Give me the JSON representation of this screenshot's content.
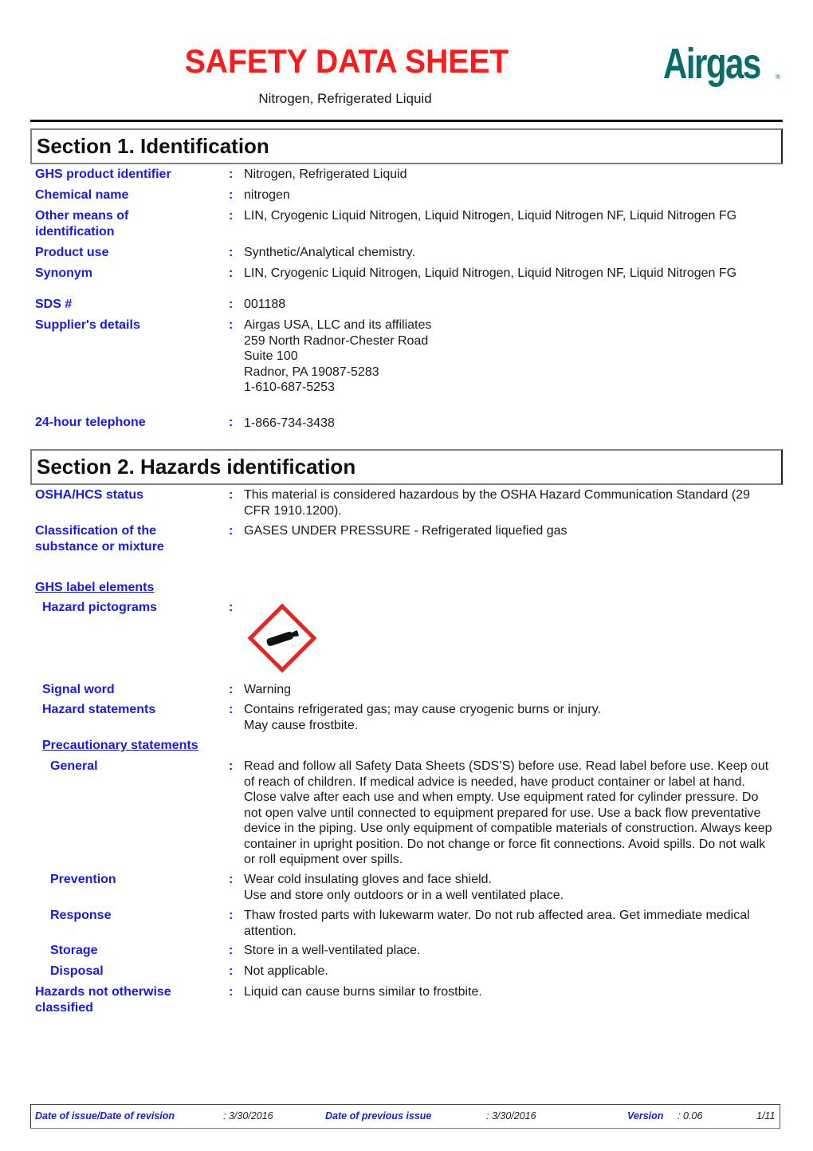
{
  "header": {
    "title": "SAFETY DATA SHEET",
    "subtitle": "Nitrogen, Refrigerated Liquid",
    "logo_text": "Airgas",
    "logo_reg": "®",
    "brand_color": "#0a6b6b",
    "title_color": "#ff1a1a"
  },
  "section1": {
    "title": "Section 1. Identification",
    "rows": [
      {
        "label": "GHS product identifier",
        "value": "Nitrogen, Refrigerated Liquid"
      },
      {
        "label": "Chemical name",
        "value": "nitrogen"
      },
      {
        "label": "Other means of identification",
        "value": "LIN, Cryogenic Liquid Nitrogen, Liquid Nitrogen, Liquid Nitrogen NF, Liquid Nitrogen FG"
      },
      {
        "label": "Product use",
        "value": "Synthetic/Analytical chemistry."
      },
      {
        "label": "Synonym",
        "value": "LIN, Cryogenic Liquid Nitrogen, Liquid Nitrogen, Liquid Nitrogen NF, Liquid Nitrogen FG"
      },
      {
        "label": "SDS #",
        "value": "001188"
      },
      {
        "label": "Supplier's details",
        "value": "Airgas USA, LLC and its affiliates\n259 North Radnor-Chester Road\nSuite 100\nRadnor, PA 19087-5283\n1-610-687-5253"
      },
      {
        "label": "24-hour telephone",
        "value": "1-866-734-3438"
      }
    ]
  },
  "section2": {
    "title": "Section 2. Hazards identification",
    "osha_status": {
      "label": "OSHA/HCS status",
      "value": "This material is considered hazardous by the OSHA Hazard Communication Standard (29 CFR 1910.1200)."
    },
    "classification": {
      "label": "Classification of the substance or mixture",
      "value": "GASES UNDER PRESSURE - Refrigerated liquefied gas"
    },
    "ghs_label_elements": "GHS label elements",
    "hazard_pictograms": {
      "label": "Hazard pictograms",
      "icon": "gas-cylinder-icon"
    },
    "signal_word": {
      "label": "Signal word",
      "value": "Warning"
    },
    "hazard_statements": {
      "label": "Hazard statements",
      "value": "Contains refrigerated gas; may cause cryogenic burns or injury.\nMay cause frostbite."
    },
    "precautionary_statements": "Precautionary statements",
    "general": {
      "label": "General",
      "value": "Read and follow all Safety Data Sheets (SDS’S) before use.  Read label before use.  Keep out of reach of children.  If medical advice is needed, have product container or label at hand.  Close valve after each use and when empty.  Use equipment rated for cylinder pressure.  Do not open valve until connected to equipment prepared for use.  Use a back flow preventative device in the piping.  Use only equipment of compatible materials of construction.  Always keep container in upright position.  Do not change or force fit connections.  Avoid spills. Do not walk or roll equipment over spills."
    },
    "prevention": {
      "label": "Prevention",
      "value": "Wear cold insulating gloves and face shield.\nUse and store only outdoors or in a well ventilated place."
    },
    "response": {
      "label": "Response",
      "value": "Thaw frosted parts with lukewarm water.  Do not rub affected area.  Get immediate medical attention."
    },
    "storage": {
      "label": "Storage",
      "value": "Store in a well-ventilated place."
    },
    "disposal": {
      "label": "Disposal",
      "value": "Not applicable."
    },
    "hnoc": {
      "label": "Hazards not otherwise classified",
      "value": "Liquid can cause burns similar to frostbite."
    },
    "colon": ":"
  },
  "footer": {
    "date_issue_label": "Date of issue/Date of revision",
    "date_issue_value": ": 3/30/2016",
    "date_prev_label": "Date of previous issue",
    "date_prev_value": ": 3/30/2016",
    "version_label": "Version",
    "version_value": ": 0.06",
    "page": "1/11"
  }
}
